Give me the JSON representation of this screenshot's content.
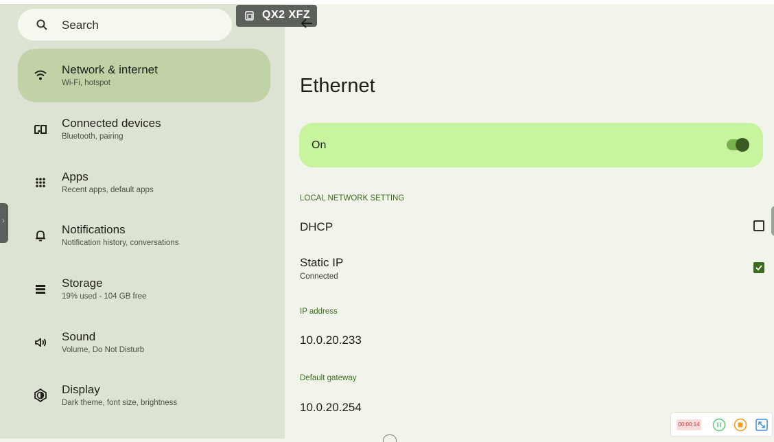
{
  "search": {
    "label": "Search",
    "icon": "search-icon"
  },
  "tag": {
    "label": "QX2 XFZ",
    "icon": "cast-window-icon"
  },
  "sidebar": {
    "items": [
      {
        "title": "Network & internet",
        "subtitle": "Wi-Fi, hotspot",
        "icon": "wifi-icon",
        "active": true
      },
      {
        "title": "Connected devices",
        "subtitle": "Bluetooth, pairing",
        "icon": "connected-devices-icon"
      },
      {
        "title": "Apps",
        "subtitle": "Recent apps, default apps",
        "icon": "apps-grid-icon"
      },
      {
        "title": "Notifications",
        "subtitle": "Notification history, conversations",
        "icon": "bell-icon"
      },
      {
        "title": "Storage",
        "subtitle": "19% used - 104 GB free",
        "icon": "storage-icon"
      },
      {
        "title": "Sound",
        "subtitle": "Volume, Do Not Disturb",
        "icon": "speaker-icon"
      },
      {
        "title": "Display",
        "subtitle": "Dark theme, font size, brightness",
        "icon": "brightness-icon"
      }
    ]
  },
  "main": {
    "title": "Ethernet",
    "toggle": {
      "label": "On",
      "state": true
    },
    "section_header": "LOCAL NETWORK SETTING",
    "dhcp": {
      "label": "DHCP",
      "checked": false
    },
    "static_ip": {
      "label": "Static IP",
      "status": "Connected",
      "checked": true
    },
    "ip_address": {
      "label": "IP address",
      "value": "10.0.20.233"
    },
    "gateway": {
      "label": "Default gateway",
      "value": "10.0.20.254"
    }
  },
  "recorder": {
    "time": "00:00:14"
  },
  "colors": {
    "accent": "#3d6a21",
    "active_item": "#c1d3a6",
    "toggle_card": "#c8f39f",
    "sidebar_bg": "#dde3d3",
    "main_bg": "#f1f4ea"
  }
}
